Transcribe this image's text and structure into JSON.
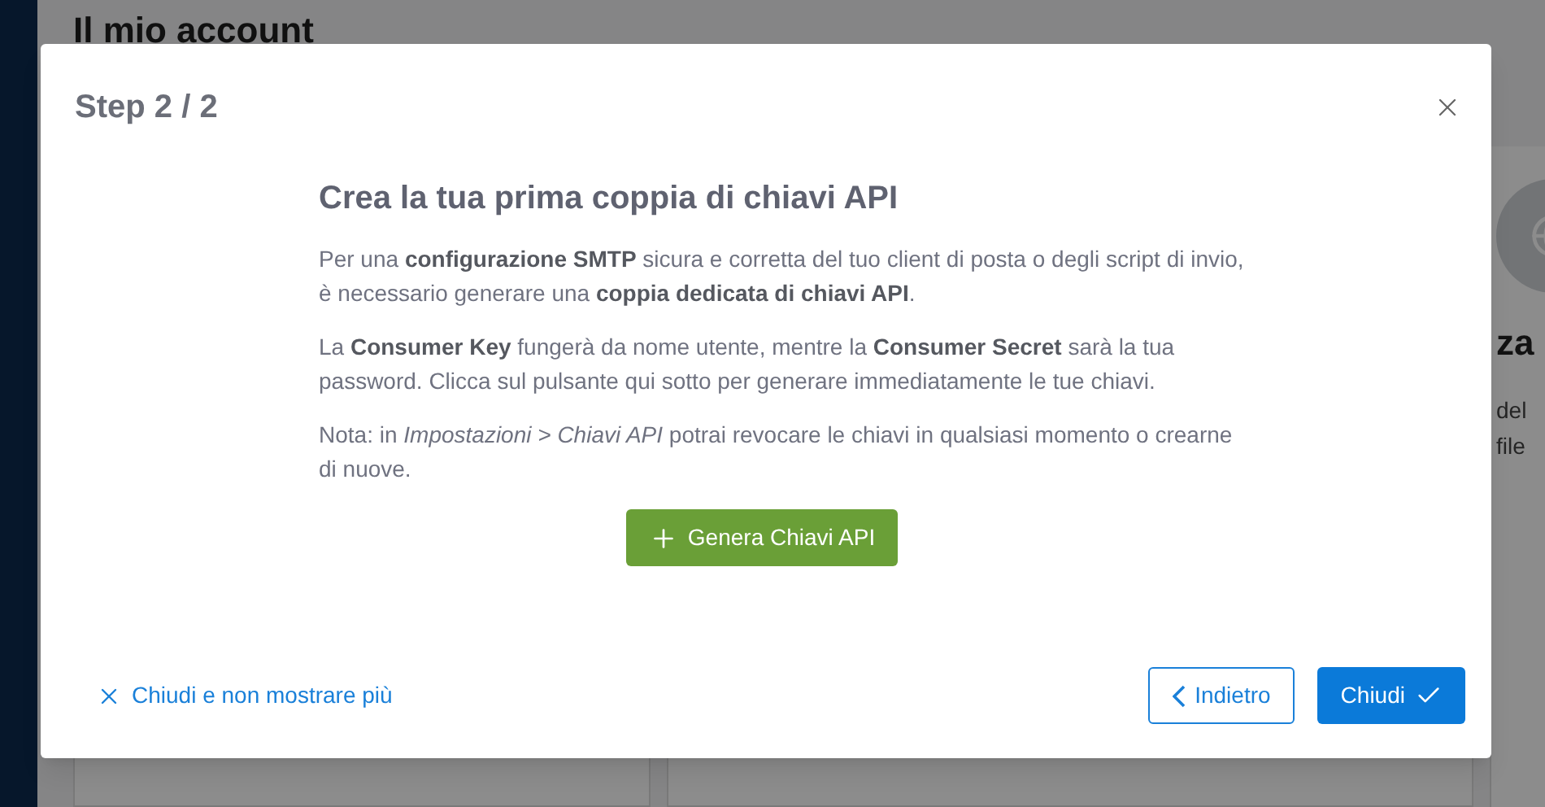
{
  "background": {
    "page_title": "Il mio account",
    "side_card": {
      "title": "za",
      "lines": [
        "del",
        "file"
      ]
    }
  },
  "dialog": {
    "title": "Step 2 / 2",
    "heading": "Crea la tua prima coppia di chiavi API",
    "paragraphs": [
      "Per una **configurazione SMTP** sicura e corretta del tuo client di posta o degli script di invio, è necessario generare una **coppia dedicata di chiavi API**.",
      "La **Consumer Key** fungerà da nome utente, mentre la **Consumer Secret** sarà la tua password. Clicca sul pulsante qui sotto per generare immediatamente le tue chiavi.",
      "Nota: in *Impostazioni > Chiavi API* potrai revocare le chiavi in qualsiasi momento o crearne di nuove."
    ],
    "generate_button": "Genera Chiavi API",
    "dismiss_link": "Chiudi e non mostrare più",
    "back_button": "Indietro",
    "close_button": "Chiudi"
  }
}
